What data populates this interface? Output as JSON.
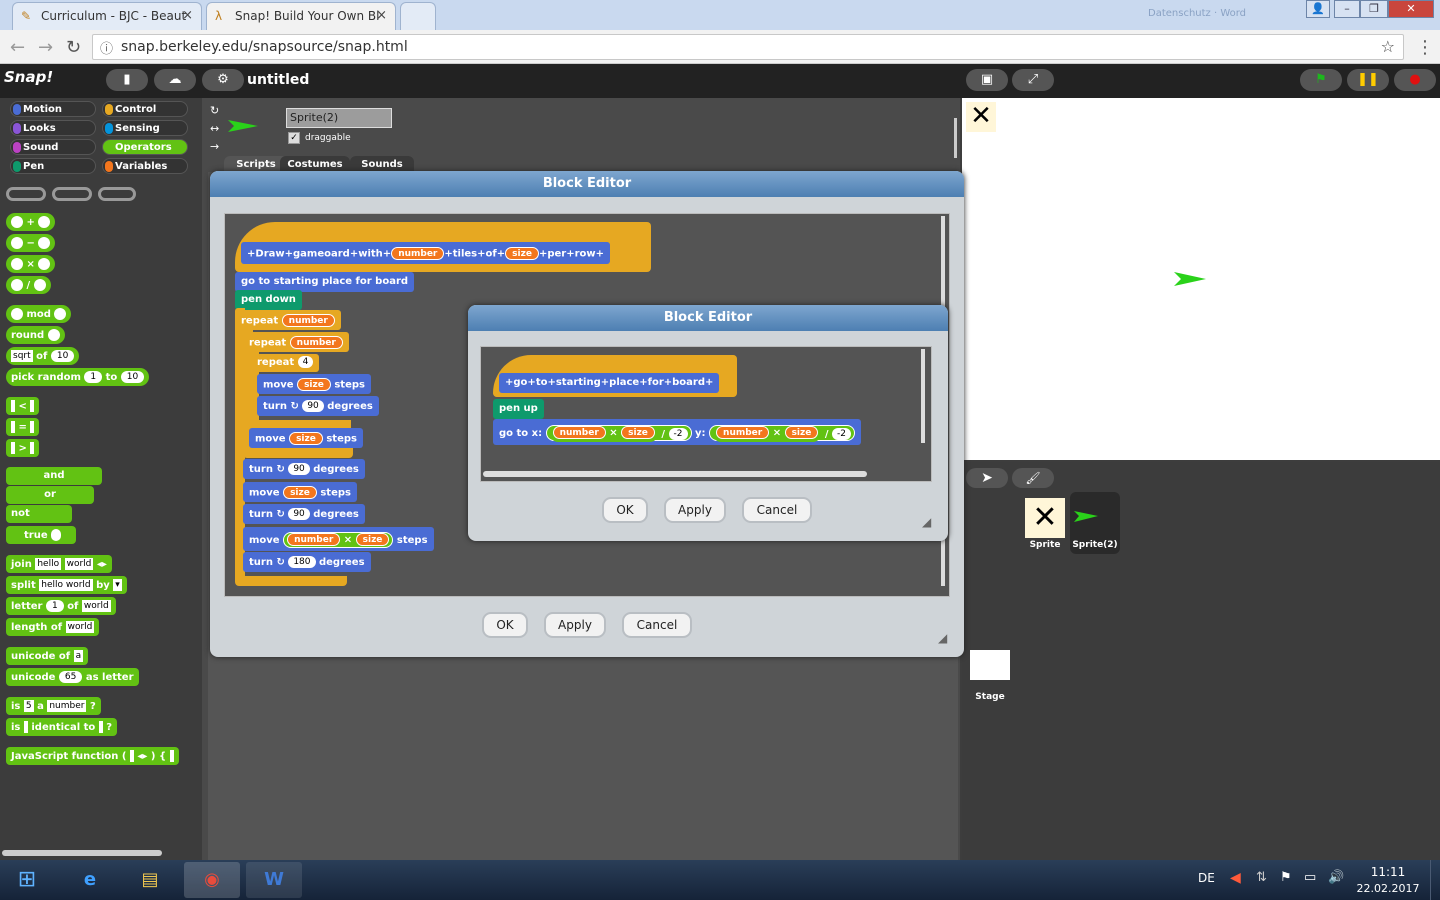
{
  "browser": {
    "tabs": [
      {
        "label": "Curriculum - BJC - Beaut",
        "close": "×"
      },
      {
        "label": "Snap! Build Your Own Bl",
        "close": "×"
      }
    ],
    "user_label": "Datenschutz · Word",
    "url": "snap.berkeley.edu/snapsource/snap.html"
  },
  "snap": {
    "logo": "Snap!",
    "project_title": "untitled",
    "categories": [
      "Motion",
      "Looks",
      "Sound",
      "Pen",
      "Control",
      "Sensing",
      "Operators",
      "Variables"
    ],
    "category_colors": [
      "#4a6cd4",
      "#8a55d7",
      "#bb42c3",
      "#0e9a6c",
      "#e6a822",
      "#0494dc",
      "#62c213",
      "#f3761d"
    ],
    "palette": {
      "plus": "+",
      "minus": "−",
      "times": "×",
      "divide": "/",
      "mod": "mod",
      "round": "round",
      "sqrt": "sqrt",
      "of": "of",
      "sqrt_val": "10",
      "pick_random": "pick random",
      "pick_from": "1",
      "to": "to",
      "pick_to": "10",
      "lt": "<",
      "eq": "=",
      "gt": ">",
      "and": "and",
      "or": "or",
      "not": "not",
      "true": "true",
      "join": "join",
      "join_a": "hello",
      "join_b": "world",
      "split": "split",
      "split_text": "hello world",
      "by": "by",
      "letter": "letter",
      "letter_n": "1",
      "letter_of": "of",
      "letter_word": "world",
      "length_of": "length of",
      "length_word": "world",
      "unicode_of": "unicode of",
      "unicode_char": "a",
      "unicode": "unicode",
      "unicode_num": "65",
      "as_letter": "as letter",
      "is": "is",
      "is_val": "5",
      "a": "a",
      "type": "number",
      "q": "?",
      "identical_to": "identical to",
      "js_function": "JavaScript function ("
    },
    "sprite": {
      "name": "Sprite(2)",
      "draggable_label": "draggable",
      "tabs": [
        "Scripts",
        "Costumes",
        "Sounds"
      ]
    },
    "corral": {
      "sprites": [
        "Sprite",
        "Sprite(2)"
      ],
      "stage_label": "Stage"
    }
  },
  "outer_editor": {
    "title": "Block Editor",
    "hat": [
      "Draw",
      "gameoard",
      "with",
      "number",
      "tiles",
      "of",
      "size",
      "per",
      "row"
    ],
    "blocks": {
      "go_to_start": "go to starting place for board",
      "pen_down": "pen down",
      "repeat": "repeat",
      "number": "number",
      "size": "size",
      "repeat4_val": "4",
      "move": "move",
      "steps": "steps",
      "turn": "turn",
      "degrees": "degrees",
      "deg90": "90",
      "deg180": "180",
      "times": "×"
    },
    "ok": "OK",
    "apply": "Apply",
    "cancel": "Cancel"
  },
  "inner_editor": {
    "title": "Block Editor",
    "hat": [
      "go",
      "to",
      "starting",
      "place",
      "for",
      "board"
    ],
    "pen_up": "pen up",
    "goto_x": "go to x:",
    "y": "y:",
    "number": "number",
    "times": "×",
    "size": "size",
    "div": "/",
    "neg2": "-2",
    "ok": "OK",
    "apply": "Apply",
    "cancel": "Cancel"
  },
  "taskbar": {
    "lang": "DE",
    "time": "11:11",
    "date": "22.02.2017"
  }
}
